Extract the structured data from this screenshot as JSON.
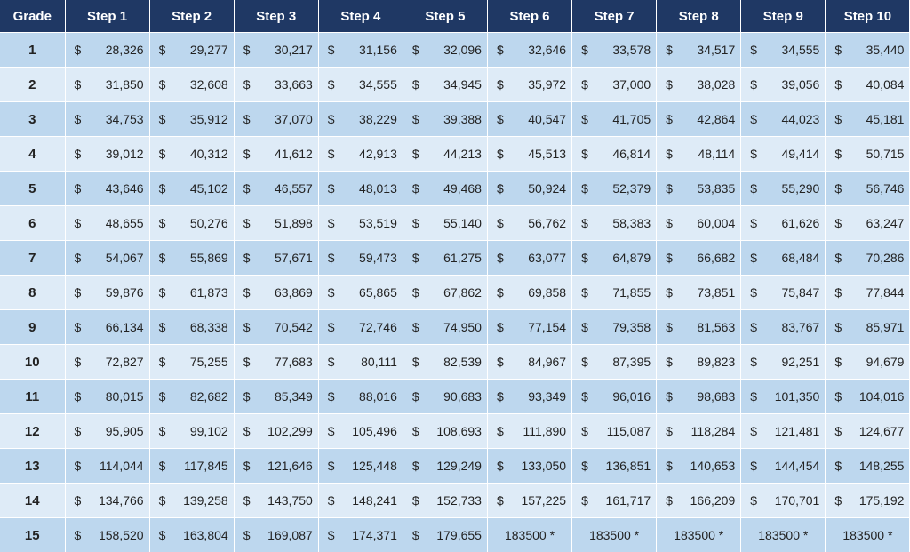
{
  "table": {
    "headers": [
      "Grade",
      "Step 1",
      "Step 2",
      "Step 3",
      "Step 4",
      "Step 5",
      "Step 6",
      "Step 7",
      "Step 8",
      "Step 9",
      "Step 10"
    ],
    "currency_symbol": "$",
    "rows": [
      {
        "grade": "1",
        "steps": [
          "28,326",
          "29,277",
          "30,217",
          "31,156",
          "32,096",
          "32,646",
          "33,578",
          "34,517",
          "34,555",
          "35,440"
        ]
      },
      {
        "grade": "2",
        "steps": [
          "31,850",
          "32,608",
          "33,663",
          "34,555",
          "34,945",
          "35,972",
          "37,000",
          "38,028",
          "39,056",
          "40,084"
        ]
      },
      {
        "grade": "3",
        "steps": [
          "34,753",
          "35,912",
          "37,070",
          "38,229",
          "39,388",
          "40,547",
          "41,705",
          "42,864",
          "44,023",
          "45,181"
        ]
      },
      {
        "grade": "4",
        "steps": [
          "39,012",
          "40,312",
          "41,612",
          "42,913",
          "44,213",
          "45,513",
          "46,814",
          "48,114",
          "49,414",
          "50,715"
        ]
      },
      {
        "grade": "5",
        "steps": [
          "43,646",
          "45,102",
          "46,557",
          "48,013",
          "49,468",
          "50,924",
          "52,379",
          "53,835",
          "55,290",
          "56,746"
        ]
      },
      {
        "grade": "6",
        "steps": [
          "48,655",
          "50,276",
          "51,898",
          "53,519",
          "55,140",
          "56,762",
          "58,383",
          "60,004",
          "61,626",
          "63,247"
        ]
      },
      {
        "grade": "7",
        "steps": [
          "54,067",
          "55,869",
          "57,671",
          "59,473",
          "61,275",
          "63,077",
          "64,879",
          "66,682",
          "68,484",
          "70,286"
        ]
      },
      {
        "grade": "8",
        "steps": [
          "59,876",
          "61,873",
          "63,869",
          "65,865",
          "67,862",
          "69,858",
          "71,855",
          "73,851",
          "75,847",
          "77,844"
        ]
      },
      {
        "grade": "9",
        "steps": [
          "66,134",
          "68,338",
          "70,542",
          "72,746",
          "74,950",
          "77,154",
          "79,358",
          "81,563",
          "83,767",
          "85,971"
        ]
      },
      {
        "grade": "10",
        "steps": [
          "72,827",
          "75,255",
          "77,683",
          "80,111",
          "82,539",
          "84,967",
          "87,395",
          "89,823",
          "92,251",
          "94,679"
        ]
      },
      {
        "grade": "11",
        "steps": [
          "80,015",
          "82,682",
          "85,349",
          "88,016",
          "90,683",
          "93,349",
          "96,016",
          "98,683",
          "101,350",
          "104,016"
        ]
      },
      {
        "grade": "12",
        "steps": [
          "95,905",
          "99,102",
          "102,299",
          "105,496",
          "108,693",
          "111,890",
          "115,087",
          "118,284",
          "121,481",
          "124,677"
        ]
      },
      {
        "grade": "13",
        "steps": [
          "114,044",
          "117,845",
          "121,646",
          "125,448",
          "129,249",
          "133,050",
          "136,851",
          "140,653",
          "144,454",
          "148,255"
        ]
      },
      {
        "grade": "14",
        "steps": [
          "134,766",
          "139,258",
          "143,750",
          "148,241",
          "152,733",
          "157,225",
          "161,717",
          "166,209",
          "170,701",
          "175,192"
        ]
      },
      {
        "grade": "15",
        "steps": [
          "158,520",
          "163,804",
          "169,087",
          "174,371",
          "179,655",
          "183500 *",
          "183500 *",
          "183500 *",
          "183500 *",
          "183500 *"
        ]
      }
    ]
  }
}
